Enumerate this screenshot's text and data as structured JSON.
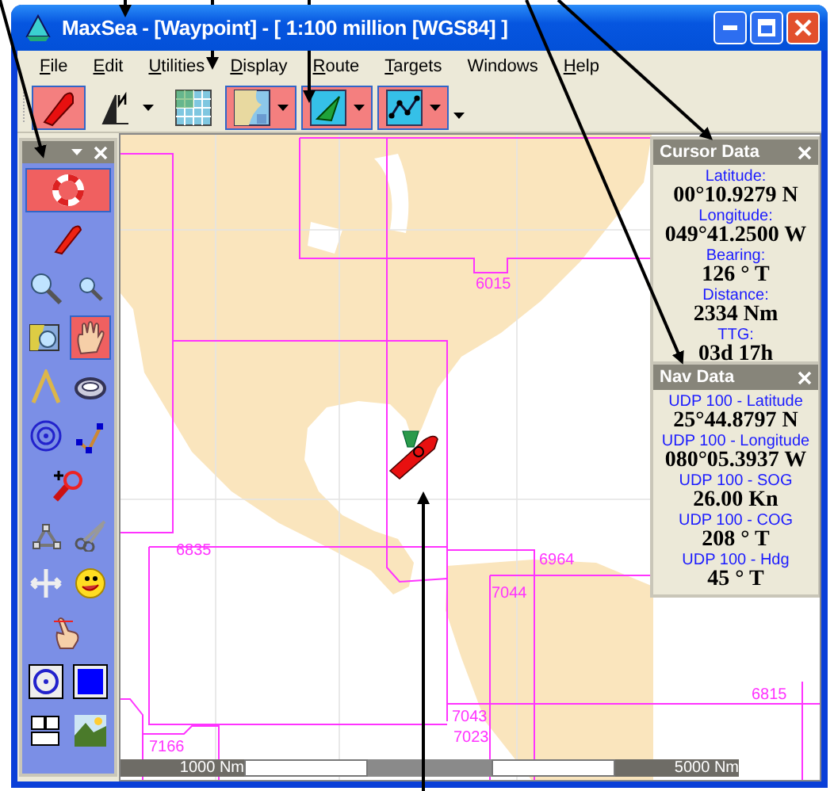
{
  "window": {
    "title": "MaxSea - [Waypoint] - [ 1:100 million [WGS84] ]"
  },
  "menu": [
    {
      "label": "File",
      "mnemonic": true
    },
    {
      "label": "Edit",
      "mnemonic": true
    },
    {
      "label": "Utilities",
      "mnemonic": true
    },
    {
      "label": "Display",
      "mnemonic": true
    },
    {
      "label": "Route",
      "mnemonic": true
    },
    {
      "label": "Targets",
      "mnemonic": true
    },
    {
      "label": "Windows",
      "mnemonic": false
    },
    {
      "label": "Help",
      "mnemonic": true
    }
  ],
  "toolbar": [
    {
      "kind": "boat",
      "selected": true,
      "dropdown": false
    },
    {
      "kind": "north",
      "selected": false,
      "dropdown": true
    },
    {
      "kind": "grid",
      "selected": false,
      "dropdown": false
    },
    {
      "kind": "chart",
      "selected": true,
      "dropdown": true
    },
    {
      "kind": "waypoint",
      "selected": true,
      "dropdown": true
    },
    {
      "kind": "route",
      "selected": true,
      "dropdown": true
    }
  ],
  "tools": [
    {
      "selected": true
    },
    {
      "selected": false
    },
    {
      "selected": false
    },
    {
      "selected": false
    },
    {
      "selected": false
    },
    {
      "selected": true
    },
    {
      "selected": false
    },
    {
      "selected": false
    },
    {
      "selected": false
    },
    {
      "selected": false
    },
    {
      "selected": false
    },
    {
      "selected": false
    },
    {
      "selected": false
    },
    {
      "selected": false
    },
    {
      "selected": false
    },
    {
      "selected": false
    },
    {
      "selected": false
    },
    {
      "selected": false
    },
    {
      "selected": false
    },
    {
      "selected": false
    }
  ],
  "chart_labels": [
    "6015",
    "6835",
    "6964",
    "7044",
    "7043",
    "7023",
    "7166",
    "6815"
  ],
  "scale": {
    "left": "1000 Nm",
    "right": "5000 Nm"
  },
  "cursor_data": {
    "title": "Cursor Data",
    "fields": [
      {
        "label": "Latitude:",
        "value": "00°10.9279 N"
      },
      {
        "label": "Longitude:",
        "value": "049°41.2500 W"
      },
      {
        "label": "Bearing:",
        "value": "126 ° T"
      },
      {
        "label": "Distance:",
        "value": "2334 Nm"
      },
      {
        "label": "TTG:",
        "value": "03d 17h"
      }
    ]
  },
  "nav_data": {
    "title": "Nav Data",
    "fields": [
      {
        "label": "UDP 100 - Latitude",
        "value": "25°44.8797 N"
      },
      {
        "label": "UDP 100 - Longitude",
        "value": "080°05.3937 W"
      },
      {
        "label": "UDP 100 - SOG",
        "value": "26.00 Kn"
      },
      {
        "label": "UDP 100 - COG",
        "value": "208 ° T"
      },
      {
        "label": "UDP 100 - Hdg",
        "value": "45 ° T"
      }
    ]
  }
}
